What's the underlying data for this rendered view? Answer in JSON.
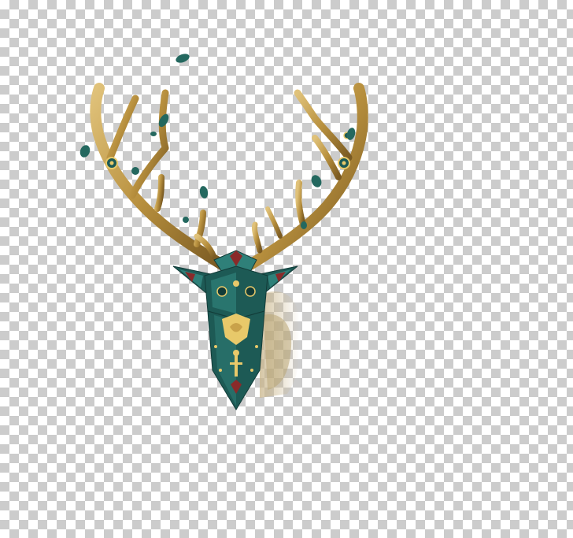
{
  "image": {
    "subject": "deer-head-illustration",
    "background": "transparency-checkerboard"
  },
  "colors": {
    "checker_light": "#ffffff",
    "checker_dark": "#cccccc",
    "antler_gold": "#b8903e",
    "antler_light": "#e0c27a",
    "antler_dark": "#7a5a22",
    "head_teal": "#1d5a55",
    "head_teal_light": "#2f8079",
    "head_teal_dark": "#123b38",
    "accent_gold": "#e8c96a",
    "accent_red": "#8a2a2a",
    "leaf_green": "#24685f",
    "brush_tan": "#c9b58a"
  }
}
